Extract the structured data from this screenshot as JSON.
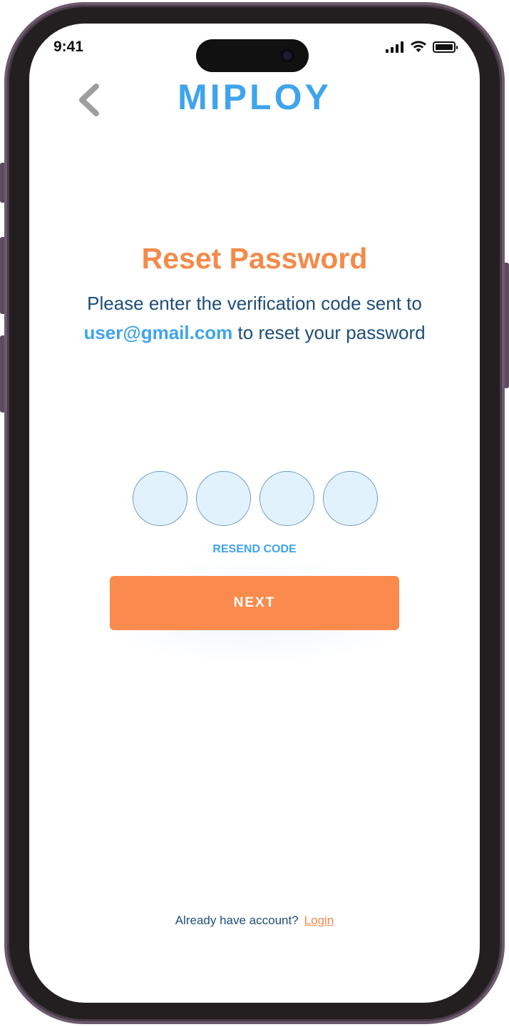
{
  "status_bar": {
    "time": "9:41"
  },
  "header": {
    "logo_text": "MIPLOY"
  },
  "main": {
    "title": "Reset Password",
    "description_prefix": "Please enter the verification code sent to",
    "email": "user@gmail.com",
    "description_suffix": "to reset your password",
    "otp": [
      "",
      "",
      "",
      ""
    ],
    "resend_label": "RESEND CODE",
    "next_label": "NEXT"
  },
  "footer": {
    "prompt": "Already have account?",
    "login_label": "Login"
  },
  "colors": {
    "primary": "#3fa4ec",
    "accent": "#fb8b4d",
    "text": "#1d4e78",
    "otp_fill": "#e2f2fd"
  },
  "icons": {
    "back": "chevron-left-icon",
    "signal": "cellular-signal-icon",
    "wifi": "wifi-icon",
    "battery": "battery-icon"
  }
}
